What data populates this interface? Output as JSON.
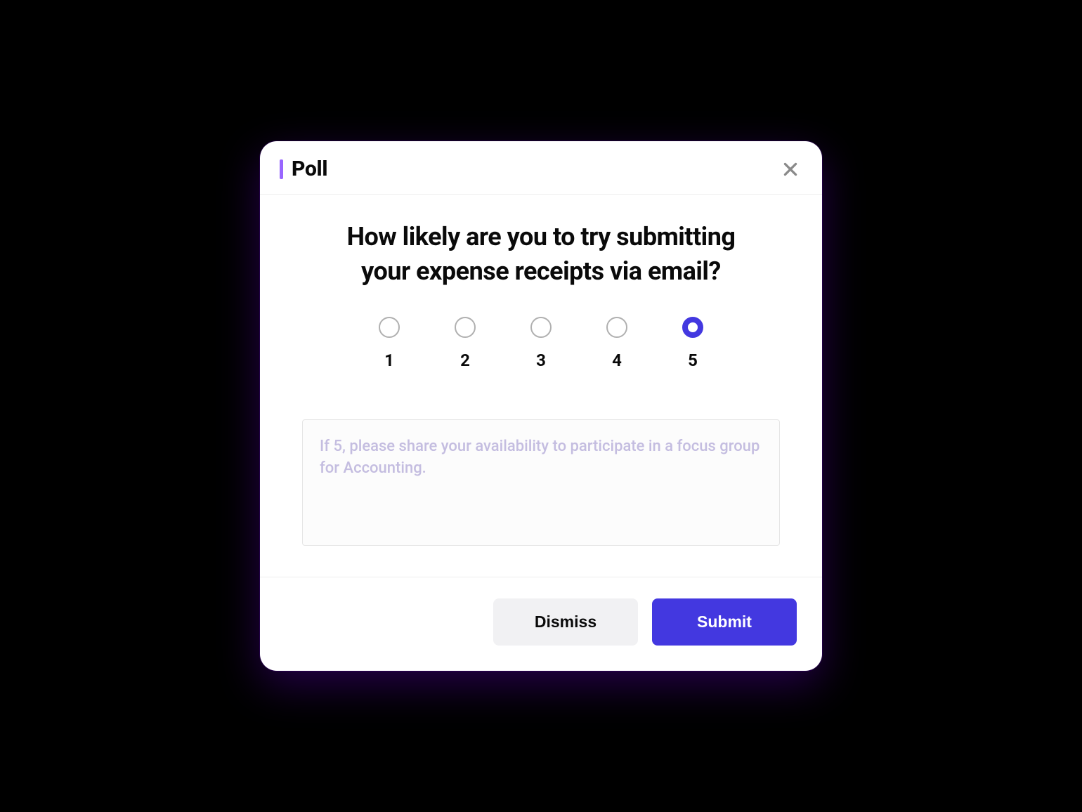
{
  "header": {
    "title": "Poll"
  },
  "question": "How likely are you to try submitting your expense receipts via email?",
  "rating": {
    "options": [
      "1",
      "2",
      "3",
      "4",
      "5"
    ],
    "selected": "5"
  },
  "comment": {
    "placeholder": "If 5, please share your availability to participate in a focus group for Accounting.",
    "value": ""
  },
  "footer": {
    "dismiss_label": "Dismiss",
    "submit_label": "Submit"
  }
}
